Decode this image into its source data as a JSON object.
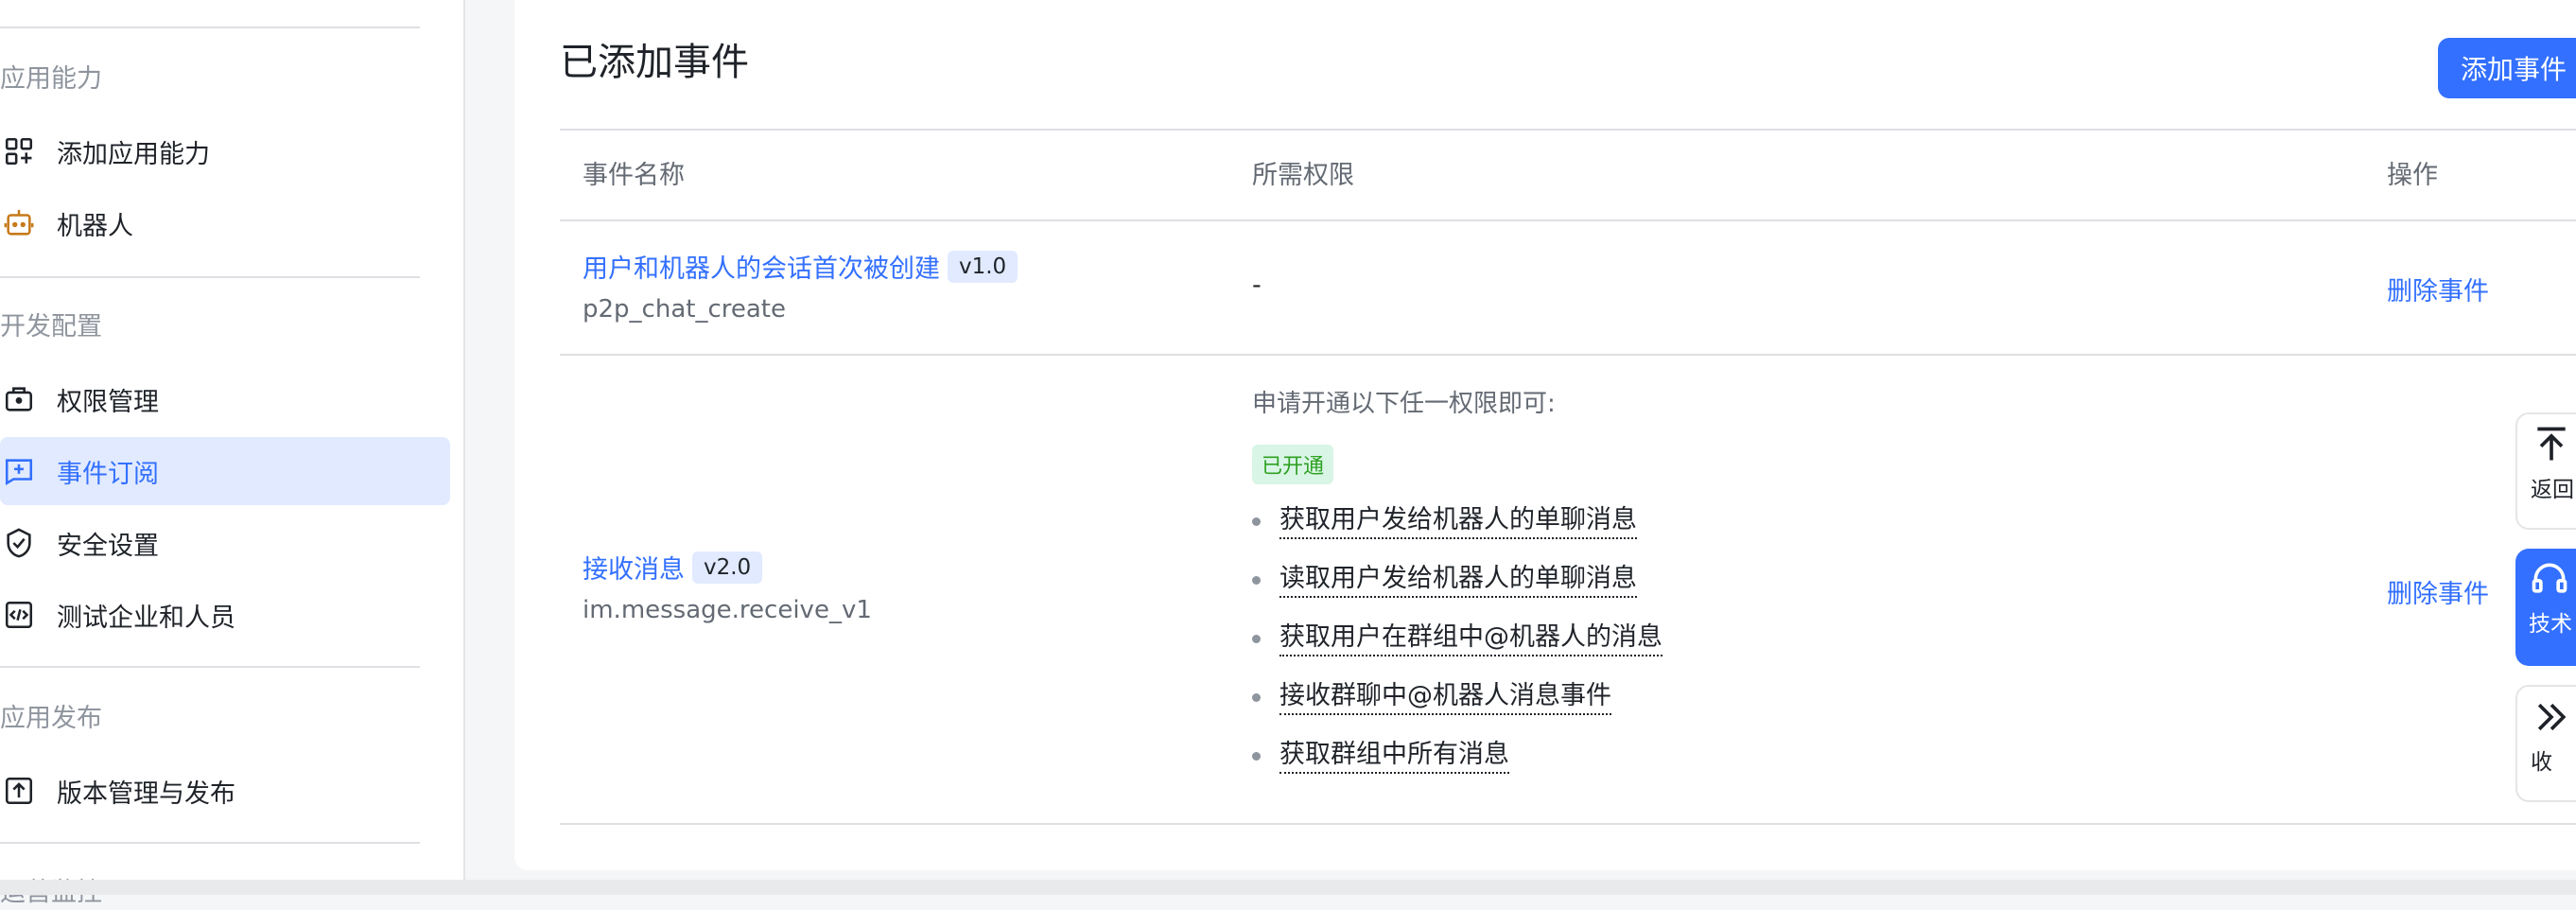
{
  "sidebar": {
    "groups": {
      "app_ability": "应用能力",
      "dev_config": "开发配置",
      "app_publish": "应用发布",
      "ops_monitor": "运营监控"
    },
    "items": [
      {
        "label": "添加应用能力",
        "icon": "add-app-icon"
      },
      {
        "label": "机器人",
        "icon": "robot-icon"
      },
      {
        "label": "权限管理",
        "icon": "permission-icon"
      },
      {
        "label": "事件订阅",
        "icon": "event-icon",
        "active": true
      },
      {
        "label": "安全设置",
        "icon": "shield-icon"
      },
      {
        "label": "测试企业和人员",
        "icon": "code-icon"
      },
      {
        "label": "版本管理与发布",
        "icon": "upload-icon"
      }
    ]
  },
  "panel": {
    "title": "已添加事件",
    "add_button": "添加事件",
    "columns": {
      "name": "事件名称",
      "permission": "所需权限",
      "action": "操作"
    },
    "rows": [
      {
        "name": "用户和机器人的会话首次被创建",
        "version": "v1.0",
        "key": "p2p_chat_create",
        "permission": "-",
        "action": "删除事件"
      },
      {
        "name": "接收消息",
        "version": "v2.0",
        "key": "im.message.receive_v1",
        "permission_intro": "申请开通以下任一权限即可:",
        "status_tag": "已开通",
        "permissions": [
          "获取用户发给机器人的单聊消息",
          "读取用户发给机器人的单聊消息",
          "获取用户在群组中@机器人的消息",
          "接收群聊中@机器人消息事件",
          "获取群组中所有消息"
        ],
        "action": "删除事件"
      }
    ]
  },
  "float_buttons": {
    "back_top": "返回",
    "support": "技术",
    "collapse": "收"
  },
  "colors": {
    "accent": "#3370ff",
    "active_bg": "#e1eaff",
    "success": "#2ea121"
  }
}
